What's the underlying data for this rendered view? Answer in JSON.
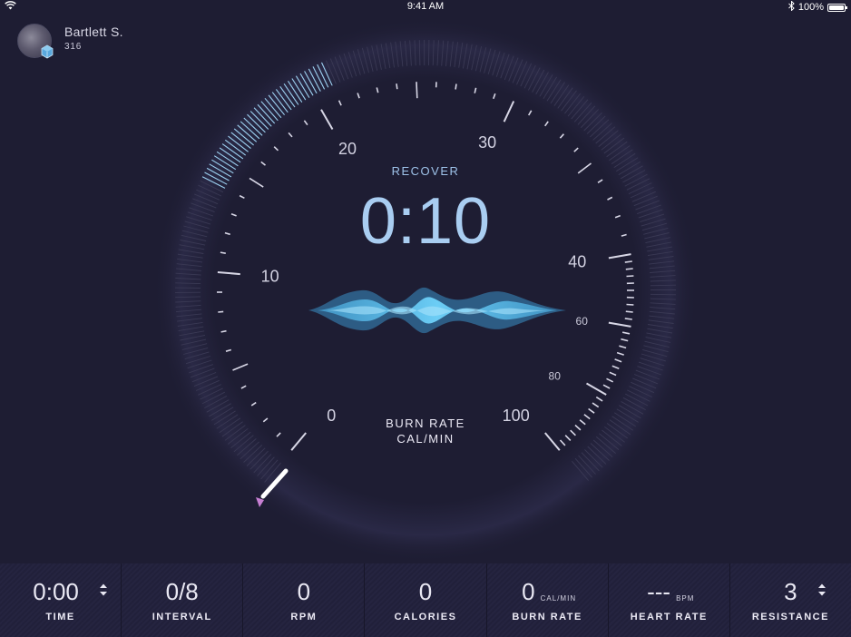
{
  "status_bar": {
    "time": "9:41 AM",
    "battery": "100%"
  },
  "user": {
    "name": "Bartlett S.",
    "score": "316"
  },
  "gauge": {
    "mode_label": "RECOVER",
    "timer": "0:10",
    "unit_line1": "BURN RATE",
    "unit_line2": "CAL/MIN",
    "scale_labels": [
      "0",
      "10",
      "20",
      "30",
      "40",
      "60",
      "80",
      "100"
    ],
    "needle_value": 0,
    "colors": {
      "accent": "#a9cdf1",
      "progress": "#9cd0f0",
      "wave": "#5bc6f0",
      "marker": "#c77fd3"
    }
  },
  "stats": [
    {
      "value": "0:00",
      "label": "TIME",
      "unit": "",
      "has_stepper": true
    },
    {
      "value": "0/8",
      "label": "INTERVAL",
      "unit": "",
      "has_stepper": false
    },
    {
      "value": "0",
      "label": "RPM",
      "unit": "",
      "has_stepper": false
    },
    {
      "value": "0",
      "label": "CALORIES",
      "unit": "",
      "has_stepper": false
    },
    {
      "value": "0",
      "label": "BURN RATE",
      "unit": "CAL/MIN",
      "has_stepper": false
    },
    {
      "value": "---",
      "label": "HEART RATE",
      "unit": "BPM",
      "has_stepper": false
    },
    {
      "value": "3",
      "label": "RESISTANCE",
      "unit": "",
      "has_stepper": true
    }
  ]
}
